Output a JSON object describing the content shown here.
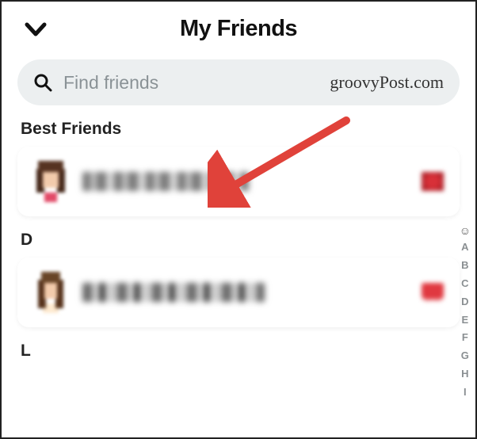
{
  "header": {
    "title": "My Friends"
  },
  "search": {
    "placeholder": "Find friends"
  },
  "watermark": "groovyPost.com",
  "sections": {
    "best_friends_label": "Best Friends",
    "d_label": "D",
    "l_label": "L"
  },
  "alpha_index": [
    "A",
    "B",
    "C",
    "D",
    "E",
    "F",
    "G",
    "H",
    "I"
  ],
  "colors": {
    "search_bg": "#eceff0",
    "text_secondary": "#8a9296",
    "arrow": "#e0423a"
  }
}
